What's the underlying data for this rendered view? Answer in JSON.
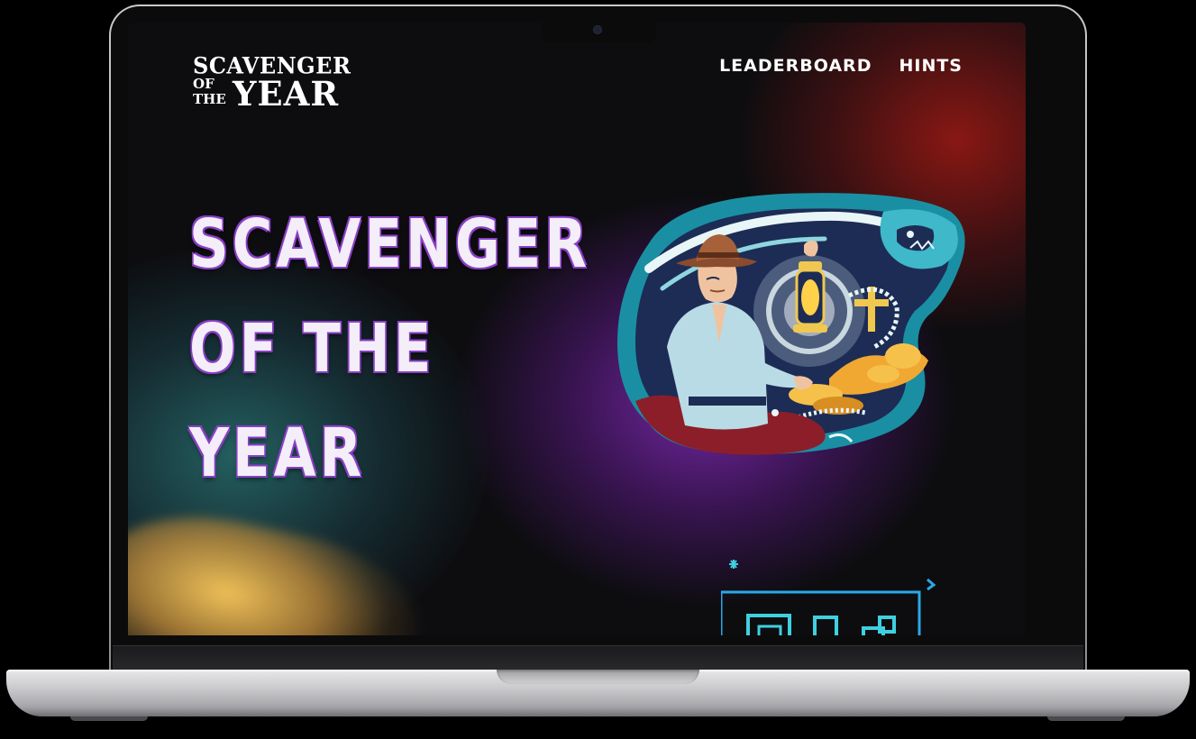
{
  "logo": {
    "line1": "SCAVENGER",
    "of": "OF",
    "the": "THE",
    "year": "YEAR"
  },
  "nav": {
    "items": [
      {
        "label": "LEADERBOARD"
      },
      {
        "label": "HINTS"
      }
    ]
  },
  "hero": {
    "title_lines": [
      "SCAVENGER",
      "OF THE",
      "YEAR"
    ]
  },
  "colors": {
    "background": "#0d0d10",
    "title_fill": "#f3eef8",
    "title_outline": "#8a3fc6",
    "accent_teal": "#1fb7c9",
    "accent_purple": "#7a28aa",
    "accent_red": "#961914",
    "laptop_silver": "#c6c6c9"
  },
  "icons": {
    "illustration": "explorer-with-lantern-illustration",
    "graphic": "puzzle-blocks-icon"
  }
}
